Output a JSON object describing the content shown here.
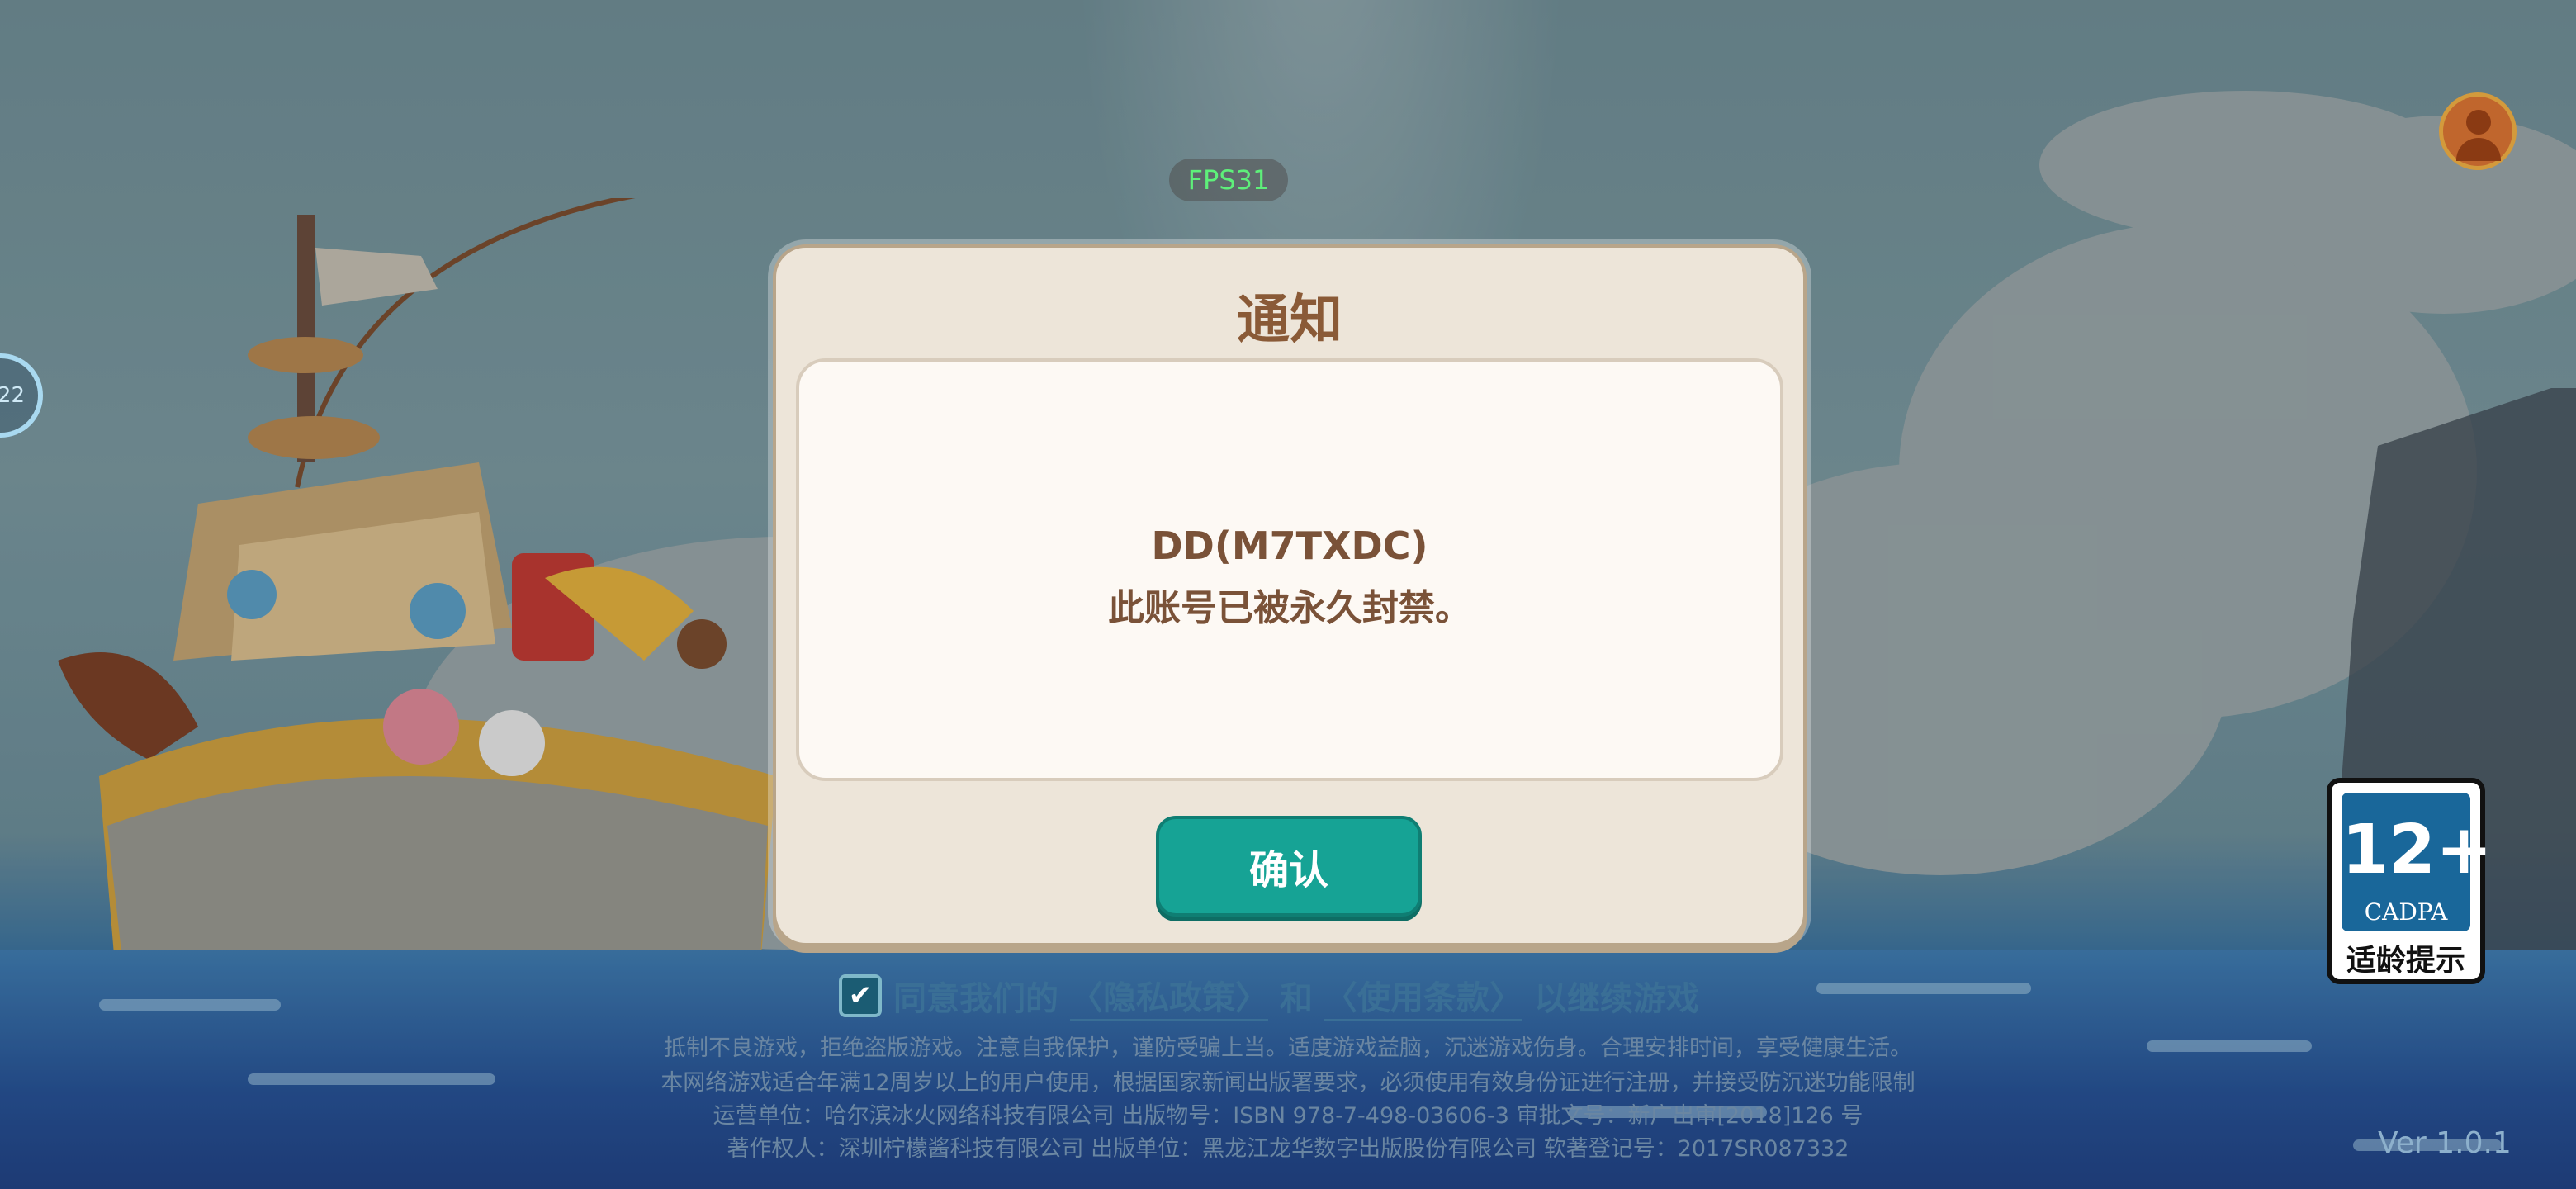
{
  "hud": {
    "fps": "FPS31",
    "side_badge": "22"
  },
  "age_rating": {
    "number": "12+",
    "org": "CADPA",
    "label": "适龄提示"
  },
  "dialog": {
    "title": "通知",
    "line1": "DD(M7TXDC)",
    "line2": "此账号已被永久封禁。",
    "confirm_label": "确认"
  },
  "agreement": {
    "checked": true,
    "prefix": "同意我们的",
    "privacy_link": "〈隐私政策〉",
    "and": "和",
    "terms_link": "〈使用条款〉",
    "suffix": "以继续游戏"
  },
  "footer_notices": [
    "抵制不良游戏，拒绝盗版游戏。注意自我保护，谨防受骗上当。适度游戏益脑，沉迷游戏伤身。合理安排时间，享受健康生活。",
    "本网络游戏适合年满12周岁以上的用户使用，根据国家新闻出版署要求，必须使用有效身份证进行注册，并接受防沉迷功能限制",
    "运营单位：哈尔滨冰火网络科技有限公司  出版物号：ISBN 978-7-498-03606-3  审批文号：新广出审[2018]126 号",
    "著作权人：深圳柠檬酱科技有限公司  出版单位：黑龙江龙华数字出版股份有限公司  软著登记号：2017SR087332"
  ],
  "version": "Ver 1.0.1",
  "colors": {
    "confirm_button": "#16a395",
    "dialog_bg": "#ede5d9",
    "title_text": "#8a5a37",
    "fps_text": "#5ef07a"
  }
}
